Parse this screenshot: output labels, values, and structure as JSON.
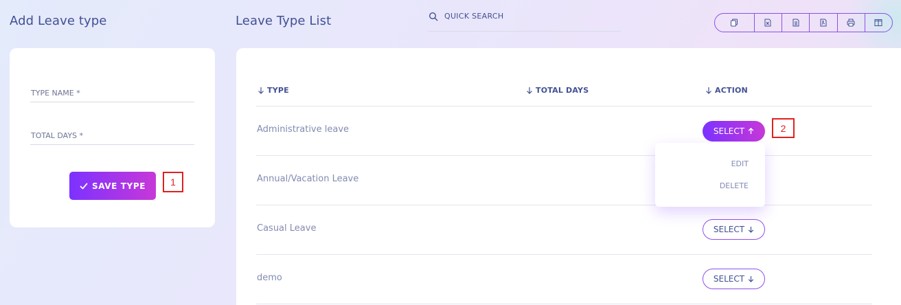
{
  "left_panel": {
    "title": "Add Leave type",
    "fields": {
      "type_name_label": "TYPE NAME *",
      "total_days_label": "TOTAL DAYS *"
    },
    "save_button_label": "SAVE TYPE"
  },
  "right_panel": {
    "title": "Leave Type List",
    "search": {
      "label": "QUICK SEARCH"
    },
    "export_icons": [
      "copy-icon",
      "excel-icon",
      "csv-icon",
      "pdf-icon",
      "print-icon",
      "columns-icon"
    ],
    "table": {
      "columns": [
        "TYPE",
        "TOTAL DAYS",
        "ACTION"
      ],
      "rows": [
        {
          "type": "Administrative leave",
          "total_days": "",
          "action": "SELECT",
          "expanded": true
        },
        {
          "type": "Annual/Vacation Leave",
          "total_days": "",
          "action": "SELECT",
          "expanded": false
        },
        {
          "type": "Casual Leave",
          "total_days": "",
          "action": "SELECT",
          "expanded": false
        },
        {
          "type": "demo",
          "total_days": "",
          "action": "SELECT",
          "expanded": false
        }
      ]
    },
    "dropdown": {
      "items": [
        "EDIT",
        "DELETE"
      ]
    }
  },
  "annotations": {
    "first": "1",
    "second": "2"
  },
  "colors": {
    "accent_start": "#7c32ff",
    "accent_end": "#c738d8",
    "text": "#415094",
    "muted": "#828bb2",
    "annotation": "#e02020"
  }
}
